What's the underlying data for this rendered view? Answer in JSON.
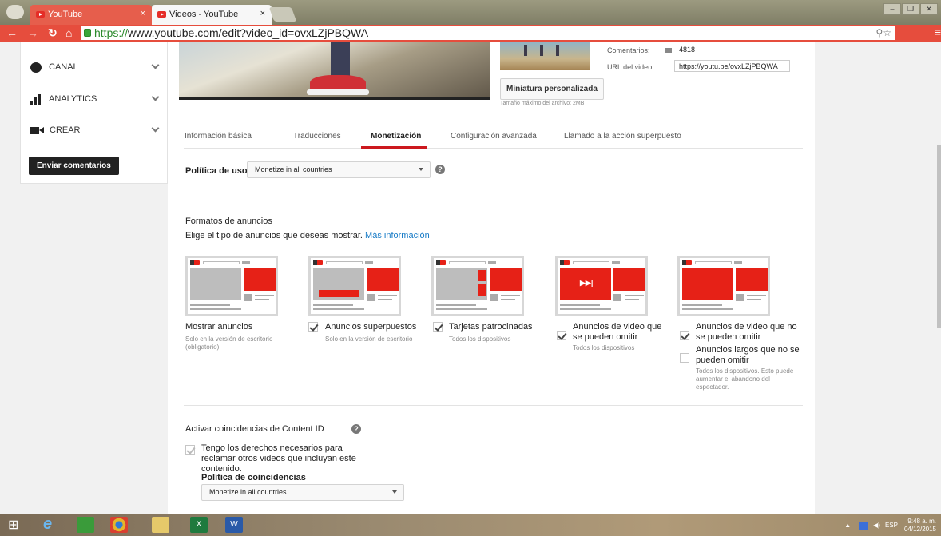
{
  "browser": {
    "tabs": [
      {
        "label": "YouTube"
      },
      {
        "label": "Videos - YouTube"
      }
    ],
    "tab_close": "×",
    "url_scheme": "https://",
    "url_rest": "www.youtube.com/edit?video_id=ovxLZjPBQWA"
  },
  "sidebar": {
    "items": [
      {
        "label": "CANAL",
        "icon": "user-circle-icon"
      },
      {
        "label": "ANALYTICS",
        "icon": "bar-chart-icon"
      },
      {
        "label": "CREAR",
        "icon": "video-camera-icon"
      }
    ],
    "feedback_label": "Enviar comentarios"
  },
  "video": {
    "comments_label": "Comentarios:",
    "comments_count": "4818",
    "url_label": "URL del video:",
    "url_value": "https://youtu.be/ovxLZjPBQWA",
    "custom_thumb_label": "Miniatura personalizada",
    "max_size_note": "Tamaño máximo del archivo: 2MB"
  },
  "tabs": [
    {
      "label": "Información básica"
    },
    {
      "label": "Traducciones"
    },
    {
      "label": "Monetización",
      "active": true
    },
    {
      "label": "Configuración avanzada"
    },
    {
      "label": "Llamado a la acción superpuesto"
    }
  ],
  "usage_policy": {
    "label": "Política de uso",
    "value": "Monetize in all countries"
  },
  "ad_formats": {
    "title": "Formatos de anuncios",
    "subtitle": "Elige el tipo de anuncios que deseas mostrar.",
    "more_info": "Más información",
    "items": [
      {
        "label": "Mostrar anuncios",
        "note": "Solo en la versión de escritorio (obligatorio)",
        "checked": false
      },
      {
        "label": "Anuncios superpuestos",
        "note": "Solo en la versión de escritorio",
        "checked": true
      },
      {
        "label": "Tarjetas patrocinadas",
        "note": "Todos los dispositivos",
        "checked": true
      },
      {
        "label": "Anuncios de video que se pueden omitir",
        "note": "Todos los dispositivos",
        "checked": true
      },
      {
        "label": "Anuncios de video que no se pueden omitir",
        "checked": true
      }
    ],
    "long_ads_label": "Anuncios largos que no se pueden omitir",
    "long_ads_checked": false,
    "long_ads_note": "Todos los dispositivos. Esto puede aumentar el abandono del espectador."
  },
  "content_id": {
    "title": "Activar coincidencias de Content ID",
    "rights_label": "Tengo los derechos necesarios para reclamar otros videos que incluyan este contenido.",
    "rights_checked": true,
    "match_policy_label": "Política de coincidencias",
    "match_policy_value": "Monetize in all countries"
  },
  "taskbar": {
    "language": "ESP",
    "time": "9:48 a. m.",
    "date": "04/12/2015"
  },
  "colors": {
    "youtube_red": "#e62117",
    "browser_accent": "#e64d3d",
    "link_blue": "#167ac6"
  }
}
